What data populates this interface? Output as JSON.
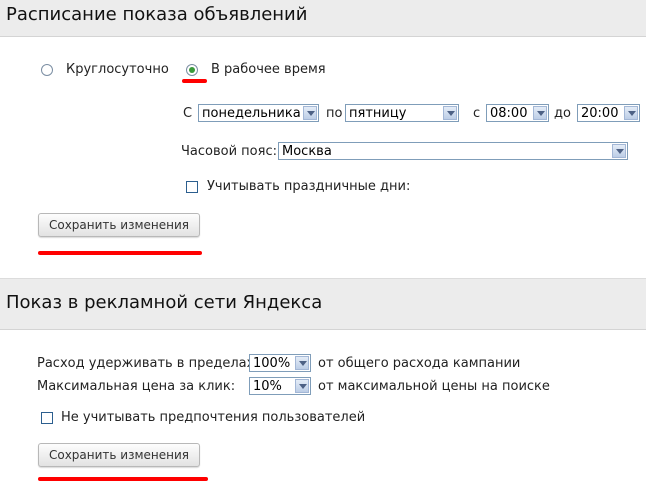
{
  "schedule": {
    "title": "Расписание показа объявлений",
    "radio_round_clock": "Круглосуточно",
    "radio_work_time": "В рабочее время",
    "from_label": "С",
    "from_day": "понедельника",
    "to_day_label": "по",
    "to_day": "пятницу",
    "from_time_label": "с",
    "from_time": "08:00",
    "to_time_label": "до",
    "to_time": "20:00",
    "timezone_label": "Часовой пояс:",
    "timezone": "Москва",
    "holidays_label": "Учитывать праздничные дни:",
    "save_label": "Сохранить изменения"
  },
  "network": {
    "title": "Показ в рекламной сети Яндекса",
    "spend_label": "Расход удерживать в пределах:",
    "spend_value": "100%",
    "spend_suffix": "от общего расхода кампании",
    "max_price_label": "Максимальная цена за клик:",
    "max_price_value": "10%",
    "max_price_suffix": "от максимальной цены на поиске",
    "ignore_prefs_label": "Не учитывать предпочтения пользователей",
    "save_label": "Сохранить изменения"
  },
  "colors": {
    "highlight": "#ff0000",
    "radio_selected": "#3a9a3a",
    "header_bg": "#ececec"
  }
}
